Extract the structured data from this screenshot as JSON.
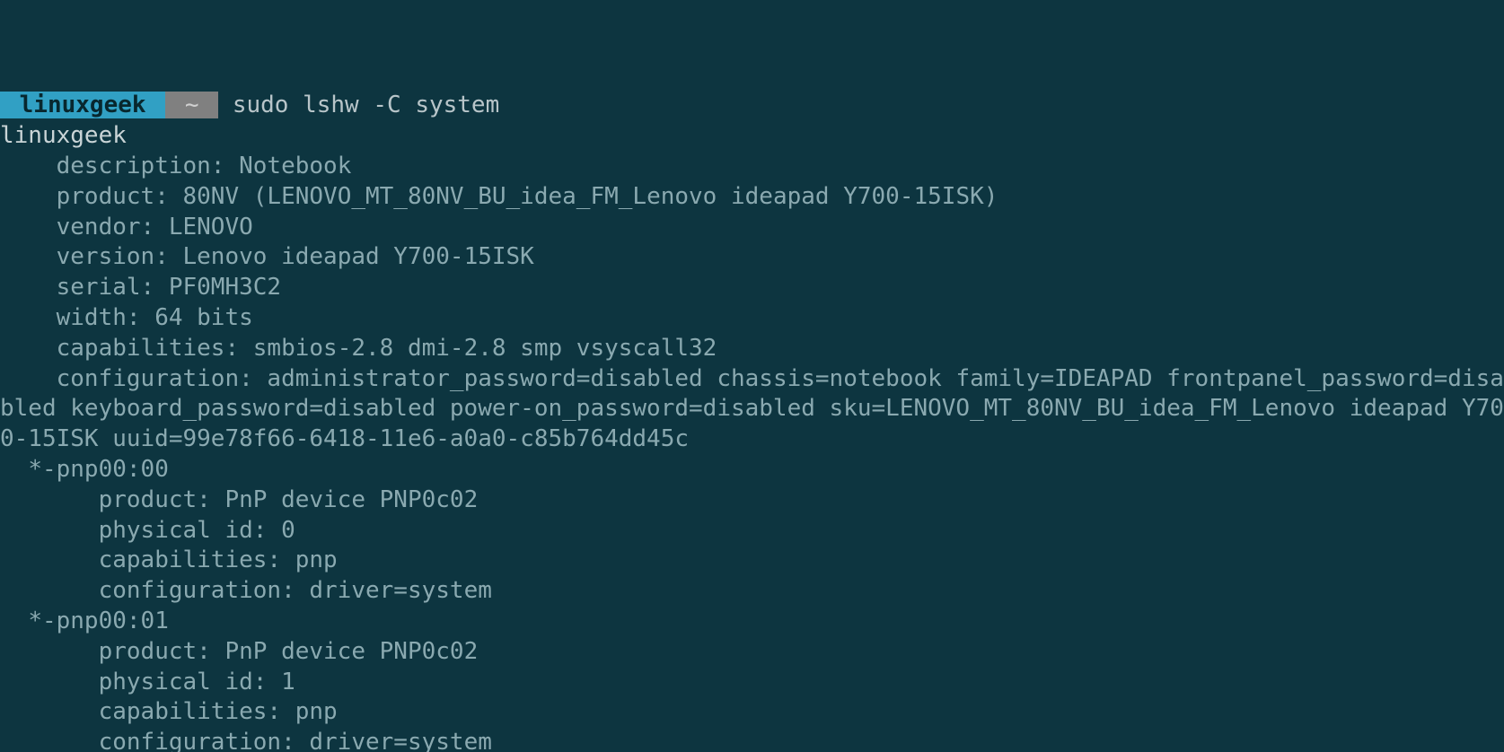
{
  "prompt": {
    "user": " linuxgeek ",
    "path": " ~ ",
    "command": "sudo lshw -C system"
  },
  "output": {
    "hostname": "linuxgeek",
    "description": "description: Notebook",
    "product": "product: 80NV (LENOVO_MT_80NV_BU_idea_FM_Lenovo ideapad Y700-15ISK)",
    "vendor": "vendor: LENOVO",
    "version": "version: Lenovo ideapad Y700-15ISK",
    "serial": "serial: PF0MH3C2",
    "width": "width: 64 bits",
    "capabilities": "capabilities: smbios-2.8 dmi-2.8 smp vsyscall32",
    "configuration": "configuration: administrator_password=disabled chassis=notebook family=IDEAPAD frontpanel_password=disabled keyboard_password=disabled power-on_password=disabled sku=LENOVO_MT_80NV_BU_idea_FM_Lenovo ideapad Y700-15ISK uuid=99e78f66-6418-11e6-a0a0-c85b764dd45c",
    "pnp0": {
      "header": "*-pnp00:00",
      "product": "product: PnP device PNP0c02",
      "physid": "physical id: 0",
      "cap": "capabilities: pnp",
      "conf": "configuration: driver=system"
    },
    "pnp1": {
      "header": "*-pnp00:01",
      "product": "product: PnP device PNP0c02",
      "physid": "physical id: 1",
      "cap": "capabilities: pnp",
      "conf": "configuration: driver=system"
    }
  }
}
